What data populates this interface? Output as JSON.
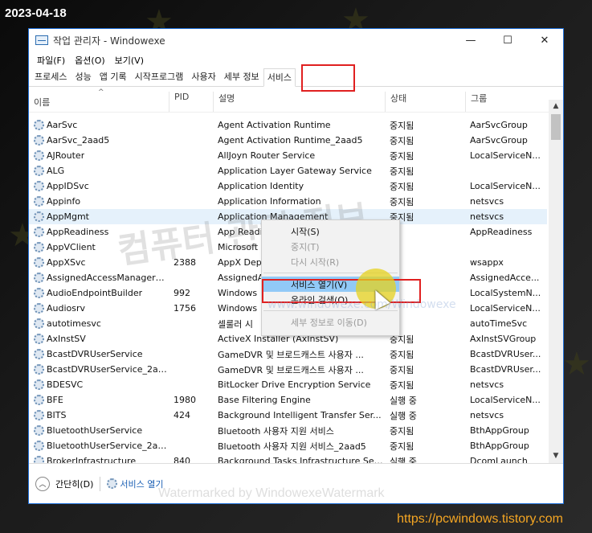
{
  "date_stamp": "2023-04-18",
  "blog_url": "https://pcwindows.tistory.com",
  "window": {
    "title": "작업 관리자  - Windowexe",
    "minimize": "—",
    "maximize": "☐",
    "close": "✕"
  },
  "menu": {
    "file": "파일(F)",
    "options": "옵션(O)",
    "view": "보기(V)"
  },
  "tabs": [
    "프로세스",
    "성능",
    "앱 기록",
    "시작프로그램",
    "사용자",
    "세부 정보",
    "서비스"
  ],
  "active_tab": "서비스",
  "columns": {
    "name": "이름",
    "pid": "PID",
    "desc": "설명",
    "status": "상태",
    "group": "그룹"
  },
  "rows": [
    {
      "name": "AarSvc",
      "pid": "",
      "desc": "Agent Activation Runtime",
      "status": "중지됨",
      "group": "AarSvcGroup"
    },
    {
      "name": "AarSvc_2aad5",
      "pid": "",
      "desc": "Agent Activation Runtime_2aad5",
      "status": "중지됨",
      "group": "AarSvcGroup"
    },
    {
      "name": "AJRouter",
      "pid": "",
      "desc": "AllJoyn Router Service",
      "status": "중지됨",
      "group": "LocalServiceN..."
    },
    {
      "name": "ALG",
      "pid": "",
      "desc": "Application Layer Gateway Service",
      "status": "중지됨",
      "group": ""
    },
    {
      "name": "AppIDSvc",
      "pid": "",
      "desc": "Application Identity",
      "status": "중지됨",
      "group": "LocalServiceN..."
    },
    {
      "name": "Appinfo",
      "pid": "",
      "desc": "Application Information",
      "status": "중지됨",
      "group": "netsvcs"
    },
    {
      "name": "AppMgmt",
      "pid": "",
      "desc": "Application Management",
      "status": "중지됨",
      "group": "netsvcs"
    },
    {
      "name": "AppReadiness",
      "pid": "",
      "desc": "App Readi",
      "status": "",
      "group": "AppReadiness"
    },
    {
      "name": "AppVClient",
      "pid": "",
      "desc": "Microsoft",
      "status": "",
      "group": ""
    },
    {
      "name": "AppXSvc",
      "pid": "2388",
      "desc": "AppX Dep",
      "status": "",
      "group": "wsappx"
    },
    {
      "name": "AssignedAccessManagerSvc",
      "pid": "",
      "desc": "AssignedA",
      "status": "",
      "group": "AssignedAcce..."
    },
    {
      "name": "AudioEndpointBuilder",
      "pid": "992",
      "desc": "Windows",
      "status": "",
      "group": "LocalSystemN..."
    },
    {
      "name": "Audiosrv",
      "pid": "1756",
      "desc": "Windows",
      "status": "",
      "group": "LocalServiceN..."
    },
    {
      "name": "autotimesvc",
      "pid": "",
      "desc": "셀룰러 시",
      "status": "",
      "group": "autoTimeSvc"
    },
    {
      "name": "AxInstSV",
      "pid": "",
      "desc": "ActiveX Installer (AxInstSV)",
      "status": "중지됨",
      "group": "AxInstSVGroup"
    },
    {
      "name": "BcastDVRUserService",
      "pid": "",
      "desc": "GameDVR 및 브로드캐스트 사용자 ...",
      "status": "중지됨",
      "group": "BcastDVRUser..."
    },
    {
      "name": "BcastDVRUserService_2aad5",
      "pid": "",
      "desc": "GameDVR 및 브로드캐스트 사용자 ...",
      "status": "중지됨",
      "group": "BcastDVRUser..."
    },
    {
      "name": "BDESVC",
      "pid": "",
      "desc": "BitLocker Drive Encryption Service",
      "status": "중지됨",
      "group": "netsvcs"
    },
    {
      "name": "BFE",
      "pid": "1980",
      "desc": "Base Filtering Engine",
      "status": "실행 중",
      "group": "LocalServiceN..."
    },
    {
      "name": "BITS",
      "pid": "424",
      "desc": "Background Intelligent Transfer Ser...",
      "status": "실행 중",
      "group": "netsvcs"
    },
    {
      "name": "BluetoothUserService",
      "pid": "",
      "desc": "Bluetooth 사용자 지원 서비스",
      "status": "중지됨",
      "group": "BthAppGroup"
    },
    {
      "name": "BluetoothUserService_2aad5",
      "pid": "",
      "desc": "Bluetooth 사용자 지원 서비스_2aad5",
      "status": "중지됨",
      "group": "BthAppGroup"
    },
    {
      "name": "BrokerInfrastructure",
      "pid": "840",
      "desc": "Background Tasks Infrastructure Ser...",
      "status": "실행 중",
      "group": "DcomLaunch"
    }
  ],
  "context_menu": {
    "start": "시작(S)",
    "stop": "중지(T)",
    "restart": "다시 시작(R)",
    "open_services": "서비스 열기(V)",
    "search_online": "온라인 검색(O)",
    "go_to_details": "세부 정보로 이동(D)"
  },
  "footer": {
    "collapse": "간단히(D)",
    "open_services": "서비스 열기"
  },
  "watermarks": {
    "korean": "컴퓨터 관련 정보",
    "overlay": "www.windowexe.com/Windowexe",
    "bottom": "Watermarked by WindowexeWatermark"
  }
}
